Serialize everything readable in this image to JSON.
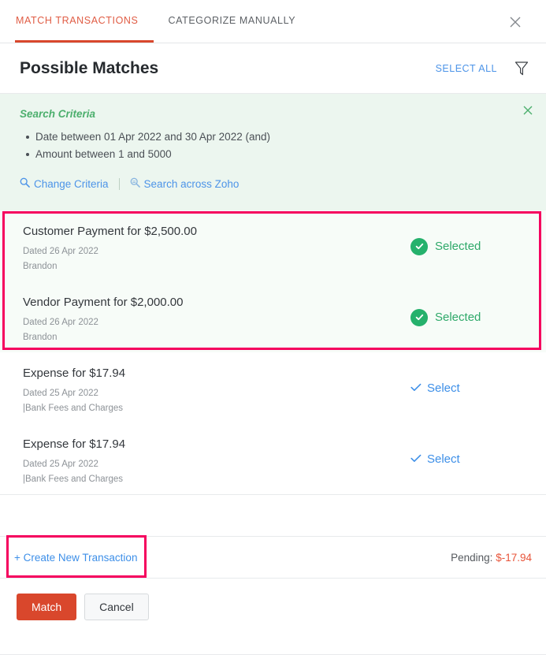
{
  "tabs": [
    {
      "label": "MATCH TRANSACTIONS",
      "active": true
    },
    {
      "label": "CATEGORIZE MANUALLY",
      "active": false
    }
  ],
  "icons": {
    "close": "close-icon",
    "filter": "filter-funnel-icon",
    "criteria_close": "close-icon",
    "search": "magnifier-icon",
    "search_zoho": "magnifier-zoho-icon",
    "check": "check-icon"
  },
  "header": {
    "title": "Possible Matches",
    "select_all_label": "SELECT ALL"
  },
  "criteria": {
    "title": "Search Criteria",
    "items": [
      "Date between 01 Apr 2022 and 30 Apr 2022  (and)",
      "Amount between 1 and 5000"
    ],
    "change_criteria_label": "Change Criteria",
    "search_across_label": "Search across Zoho"
  },
  "matches": [
    {
      "title": "Customer Payment for $2,500.00",
      "date": "Dated 26 Apr 2022",
      "sub": "Brandon",
      "action_label": "Selected",
      "selected": true
    },
    {
      "title": "Vendor Payment for $2,000.00",
      "date": "Dated 26 Apr 2022",
      "sub": "Brandon",
      "action_label": "Selected",
      "selected": true
    },
    {
      "title": "Expense for $17.94",
      "date": "Dated 25 Apr 2022",
      "sub": "|Bank Fees and Charges",
      "action_label": "Select",
      "selected": false
    },
    {
      "title": "Expense for $17.94",
      "date": "Dated 25 Apr 2022",
      "sub": "|Bank Fees and Charges",
      "action_label": "Select",
      "selected": false
    }
  ],
  "footer": {
    "create_new_label": "+ Create New Transaction",
    "pending_label": "Pending:",
    "pending_amount": "$-17.94",
    "match_button": "Match",
    "cancel_button": "Cancel"
  },
  "colors": {
    "accent_red": "#d9472c",
    "highlight_pink": "#f5005e",
    "link_blue": "#3d8fe8",
    "green": "#25b16c",
    "criteria_bg": "#ecf6ef",
    "pending_red": "#e8543a"
  }
}
